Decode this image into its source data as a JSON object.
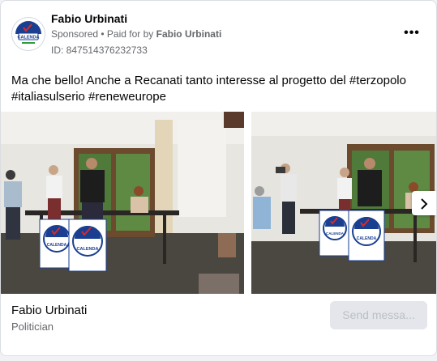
{
  "header": {
    "page_name": "Fabio Urbinati",
    "sponsored_label": "Sponsored",
    "separator": " • ",
    "paid_prefix": "Paid for by ",
    "paid_by": "Fabio Urbinati",
    "ad_id": "ID: 847514376232733",
    "more_icon": "more-horizontal-icon"
  },
  "avatar": {
    "text_top": "Calenda",
    "text_bottom": "CALENDA"
  },
  "post": {
    "text": "Ma che bello! Anche a Recanati tanto interesse al progetto del #terzopolo #italiasulserio #reneweurope"
  },
  "carousel": {
    "slides": [
      {
        "poster_text": "CALENDA"
      },
      {
        "poster_text": "CALENDA"
      }
    ],
    "next_icon": "chevron-right-icon"
  },
  "footer": {
    "name": "Fabio Urbinati",
    "category": "Politician",
    "cta_label": "Send messa..."
  },
  "colors": {
    "brand_blue": "#1a3f91",
    "accent_red": "#d62b2b",
    "accent_green": "#2e9b3c"
  }
}
